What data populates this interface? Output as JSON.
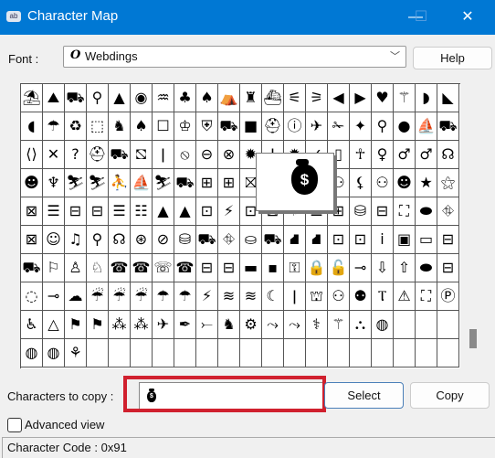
{
  "window": {
    "title": "Character Map",
    "icon": "charmap-app-icon"
  },
  "font": {
    "label": "Font :",
    "value": "Webdings",
    "font_icon": "opentype-font-icon"
  },
  "help_label": "Help",
  "grid_rows": [
    [
      "⛱",
      "⛰",
      "⛟",
      "⚲",
      "▲",
      "◉",
      "♒",
      "♣",
      "♠",
      "⛺",
      "♜",
      "⛴",
      "⚟",
      "⚞",
      "◀",
      "▶",
      "♥",
      "⚚",
      "◗",
      "◣"
    ],
    [
      "◖",
      "☂",
      "♻",
      "⬚",
      "♞",
      "♠",
      "☐",
      "♔",
      "⛨",
      "⛟",
      "■",
      "⛑",
      "ⓘ",
      "✈",
      "✁",
      "✦",
      "⚲",
      "●",
      "⛵",
      "⛟"
    ],
    [
      "⟨⟩",
      "✕",
      "?",
      "⛑",
      "⛟",
      "⛞",
      "ǀ",
      "⦸",
      "⊖",
      "⊗",
      "✹",
      "ǀ",
      "✹",
      "✓",
      "▯",
      "☥",
      "♀",
      "♂",
      "♂",
      "☊"
    ],
    [
      "☻",
      "♆",
      "⛷",
      "⛷",
      "⛹",
      "⛵",
      "⛷",
      "⛟",
      "⊞",
      "⊞",
      "⛝",
      "▢",
      "▢",
      "⛁",
      "⚇",
      "⚸",
      "⚇",
      "☻",
      "★",
      "⚝"
    ],
    [
      "⊠",
      "☰",
      "⊟",
      "⊟",
      "☰",
      "☷",
      "▲",
      "▲",
      "⊡",
      "⚡",
      "⊡",
      "⊠",
      "♯",
      "☰",
      "⊞",
      "⛁",
      "⊟",
      "⛶",
      "⬬",
      "⛗"
    ],
    [
      "⊠",
      "☺",
      "♫",
      "⚲",
      "☊",
      "⊛",
      "⊘",
      "⛁",
      "⛟",
      "⛗",
      "⛀",
      "⛟",
      "⛘",
      "⛘",
      "⊡",
      "⊡",
      "ⅰ",
      "▣",
      "▭",
      "⊟"
    ],
    [
      "⛟",
      "⚐",
      "♙",
      "♘",
      "☎",
      "☎",
      "☏",
      "☎",
      "⊟",
      "⊟",
      "▬",
      "▪",
      "⚿",
      "🔒",
      "🔓",
      "⊸",
      "⇩",
      "⇧",
      "⬬",
      "⊟"
    ],
    [
      "◌",
      "⊸",
      "☁",
      "☔",
      "☔",
      "☔",
      "☂",
      "☂",
      "⚡",
      "≋",
      "≋",
      "☾",
      "ǀ",
      "⛫",
      "⚇",
      "⚉",
      "Ⲧ",
      "⚠",
      "⛶",
      "Ⓟ"
    ],
    [
      "♿",
      "△",
      "⚑",
      "⚑",
      "⁂",
      "⁂",
      "✈",
      "✒",
      "⤚",
      "♞",
      "⚙",
      "⤳",
      "⤳",
      "⚕",
      "⚚",
      "⛬",
      "◍",
      "",
      "",
      ""
    ],
    [
      "◍",
      "◍",
      "⚘",
      "",
      "",
      "",
      "",
      "",
      "",
      "",
      "",
      "",
      "",
      "",
      "",
      "",
      "",
      "",
      "",
      ""
    ]
  ],
  "preview": {
    "glyph": "$",
    "glyph_icon": "money-bag-icon"
  },
  "copy": {
    "label": "Characters to copy :",
    "value": "$",
    "value_icon": "money-bag-icon",
    "select_label": "Select",
    "copy_label": "Copy"
  },
  "advanced_view": {
    "label": "Advanced view",
    "checked": false
  },
  "status": {
    "text": "Character Code : 0x91"
  },
  "colors": {
    "titlebar": "#0078d4",
    "highlight": "#d0202e"
  }
}
